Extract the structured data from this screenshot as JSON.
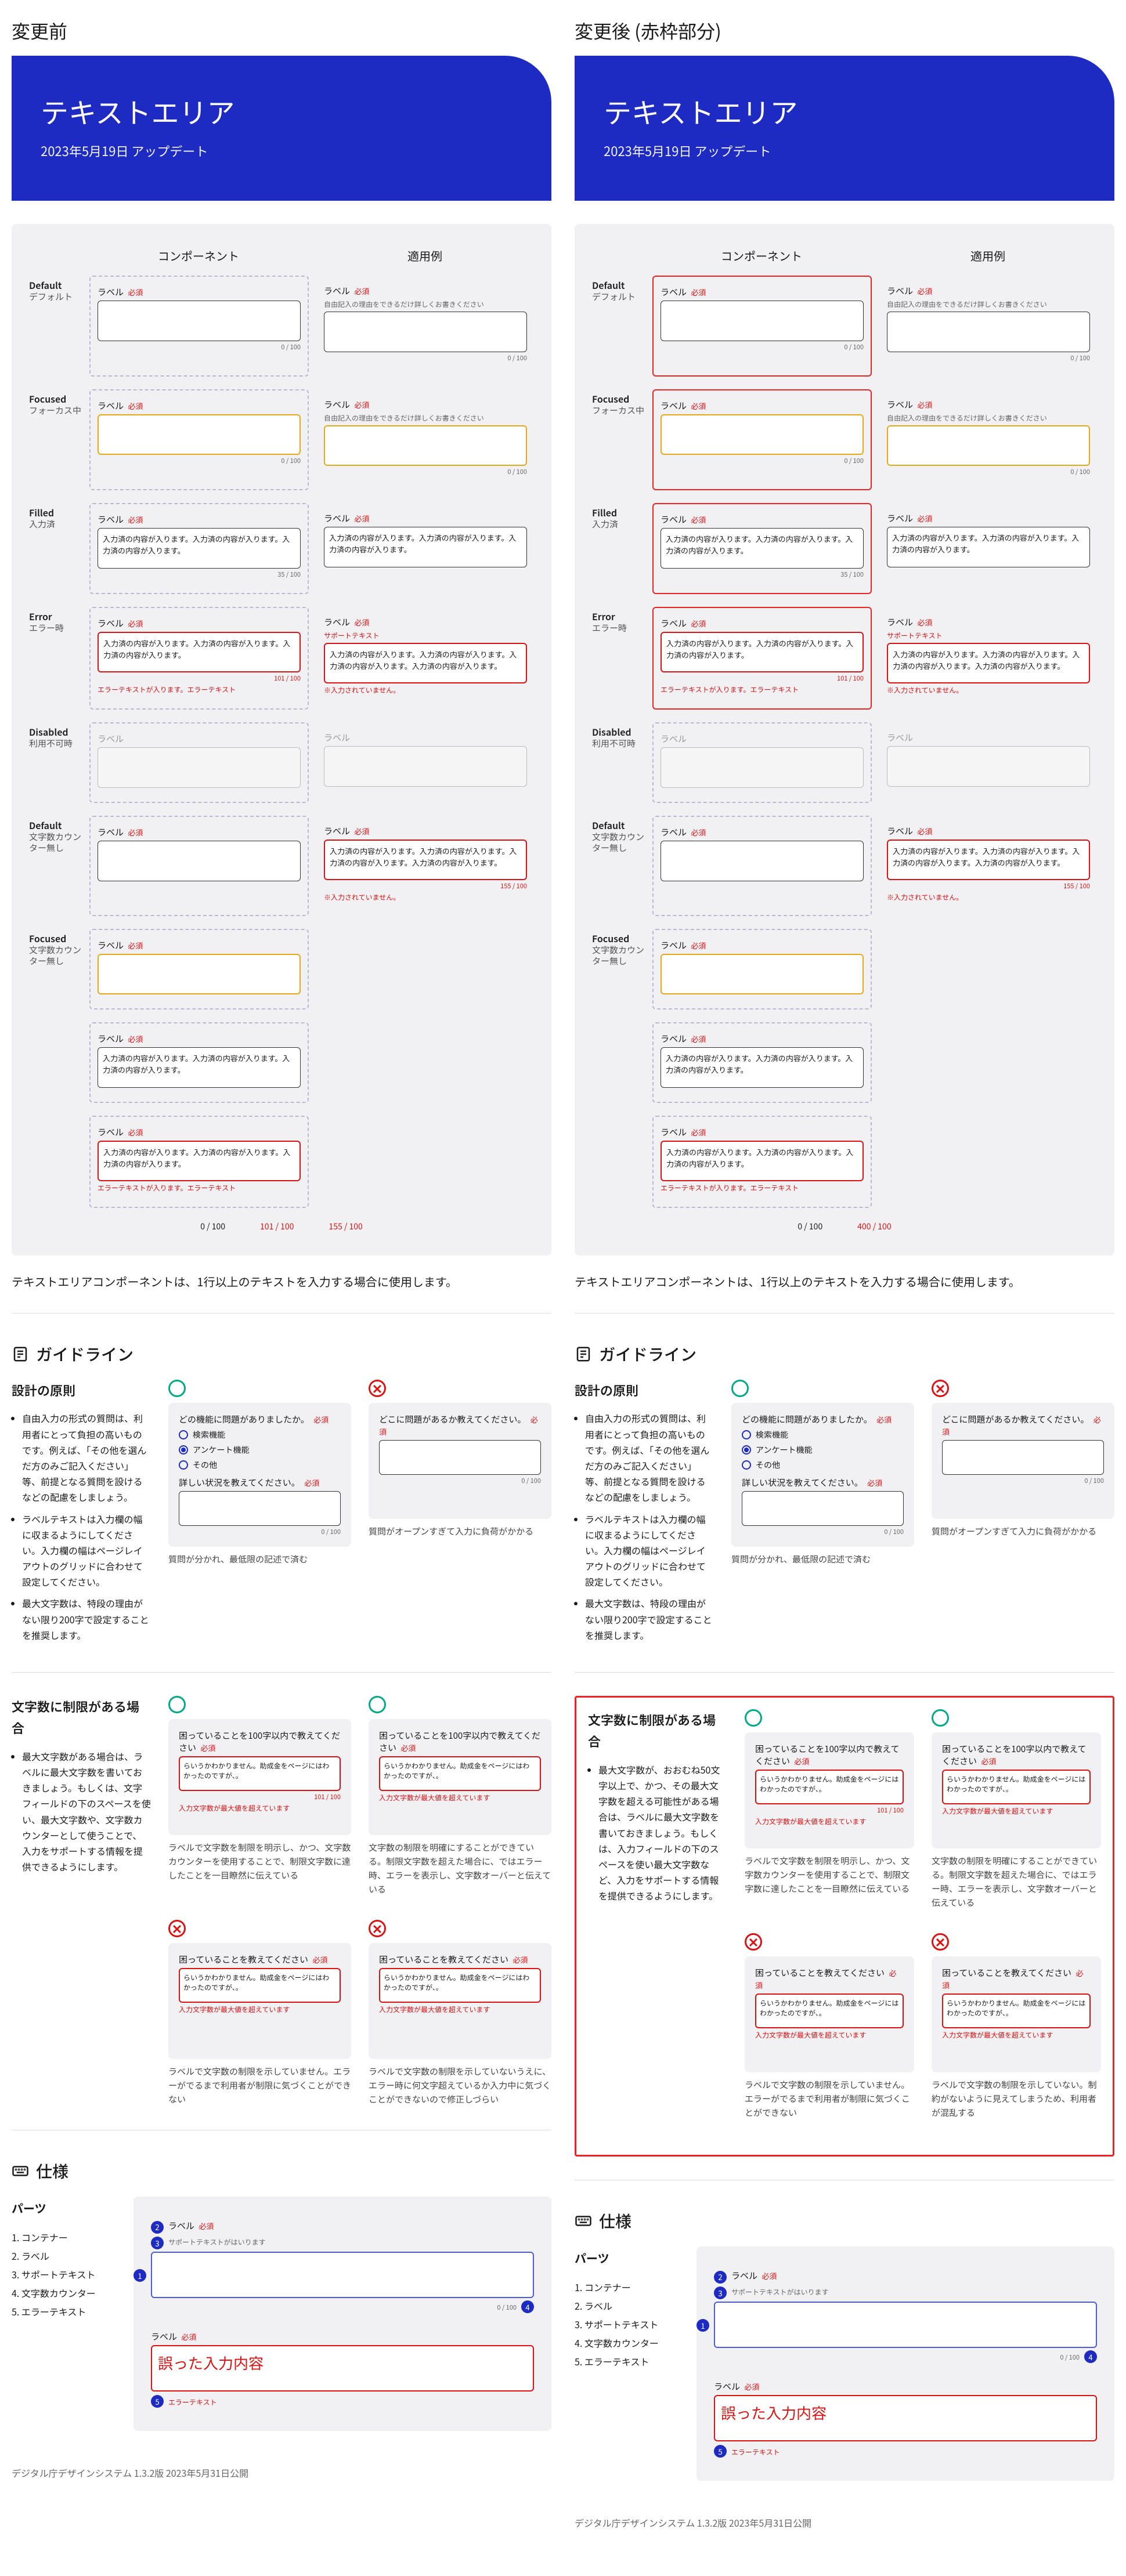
{
  "columns": {
    "before": "変更前",
    "after": "変更後 (赤枠部分)"
  },
  "hero": {
    "title": "テキストエリア",
    "date": "2023年5月19日 アップデート"
  },
  "componentSection": {
    "colComponent": "コンポーネント",
    "colUsage": "適用例",
    "states": [
      {
        "key": "default",
        "en": "Default",
        "ja": "デフォルト"
      },
      {
        "key": "focused",
        "en": "Focused",
        "ja": "フォーカス中"
      },
      {
        "key": "filled",
        "en": "Filled",
        "ja": "入力済"
      },
      {
        "key": "error",
        "en": "Error",
        "ja": "エラー時"
      },
      {
        "key": "disabled",
        "en": "Disabled",
        "ja": "利用不可時"
      },
      {
        "key": "defaultCounter",
        "en": "Default",
        "ja": "文字数カウンター無し"
      },
      {
        "key": "focusedCounter",
        "en": "Focused",
        "ja": "文字数カウンター無し"
      }
    ],
    "label": "ラベル",
    "required": "必須",
    "support": "自由記入の理由をできるだけ詳しくお書きください",
    "supportAlt": "サポートテキスト",
    "filledText": "入力済の内容が入ります。入力済の内容が入ります。入力済の内容が入ります。",
    "filledTextLong": "入力済の内容が入ります。入力済の内容が入ります。入力済の内容が入ります。入力済の内容が入ります。",
    "errorMsg": "エラーテキストが入ります。エラーテキスト",
    "errorMsgAlt": "※入力されていません。",
    "counts": {
      "empty": "0 / 100",
      "filled": "35 / 100",
      "error": "101 / 100",
      "overLong": "155 / 100"
    },
    "counterRow": [
      "0 / 100",
      "101 / 100",
      "155 / 100"
    ],
    "counterRowAfter": [
      "0 / 100",
      "400 / 100"
    ]
  },
  "caption": "テキストエリアコンポーネントは、1行以上のテキストを入力する場合に使用します。",
  "guidelineTitle": "ガイドライン",
  "principles": {
    "heading": "設計の原則",
    "bullets": [
      "自由入力の形式の質問は、利用者にとって負担の高いものです。例えば、「その他を選んだ方のみご記入ください」等、前提となる質問を設けるなどの配慮をしましょう。",
      "ラベルテキストは入力欄の幅に収まるようにしてください。入力欄の幅はページレイアウトのグリッドに合わせて設定してください。",
      "最大文字数は、特段の理由がない限り200字で設定することを推奨します。"
    ],
    "goodLabel": "どの機能に問題がありましたか。",
    "radios": [
      "検索機能",
      "アンケート機能",
      "その他"
    ],
    "goodTaLabel": "詳しい状況を教えてください。",
    "goodCaption": "質問が分かれ、最低限の記述で済む",
    "badLabel": "どこに問題があるか教えてください。",
    "badCaption": "質問がオープンすぎて入力に負荷がかかる",
    "count": "0 / 100"
  },
  "charLimit": {
    "heading": "文字数に制限がある場合",
    "bulletsBefore": [
      "最大文字数がある場合は、ラベルに最大文字数を書いておきましょう。もしくは、文字フィールドの下のスペースを使い、最大文字数や、文字数カウンターとして使うことで、入力をサポートする情報を提供できるようにします。"
    ],
    "bulletsAfter": [
      "最大文字数が、おおむね50文字以上で、かつ、その最大文字数を超える可能性がある場合は、ラベルに最大文字数を書いておきましょう。もしくは、入力フィールドの下のスペースを使い最大文字数など、入力をサポートする情報を提供できるようにします。"
    ],
    "goodA": {
      "label": "困っていることを100字以内で教えてください",
      "text": "らいうかわかりません。助成金をページにはわかったのですが、。",
      "count": "101 / 100",
      "err": "入力文字数が最大値を超えています",
      "caption": "ラベルで文字数を制限を明示し、かつ、文字数カウンターを使用することで、制限文字数に達したことを一目瞭然に伝えている"
    },
    "goodB": {
      "label": "困っていることを100字以内で教えてください",
      "text": "らいうかわかりません。助成金をページにはわかったのですが、。",
      "err": "入力文字数が最大値を超えています",
      "caption": "文字数の制限を明確にすることができている。制限文字数を超えた場合に、ではエラー時、エラーを表示し、文字数オーバーと伝えている"
    },
    "badA": {
      "label": "困っていることを教えてください",
      "text": "らいうかわかりません。助成金をページにはわかったのですが、。",
      "err": "入力文字数が最大値を超えています",
      "caption": "ラベルで文字数の制限を示していません。エラーがでるまで利用者が制限に気づくことができない"
    },
    "badB": {
      "label": "困っていることを教えてください",
      "text": "らいうかわかりません。助成金をページにはわかったのですが、。",
      "err": "入力文字数が最大値を超えています",
      "caption": "ラベルで文字数の制限を示していないうえに、エラー時に何文字超えているか入力中に気づくことができないので修正しづらい"
    },
    "badBAfter": {
      "caption": "ラベルで文字数の制限を示していない。制約がないように見えてしまうため、利用者が混乱する"
    }
  },
  "specTitle": "仕様",
  "parts": {
    "heading": "パーツ",
    "list": [
      "1. コンテナー",
      "2. ラベル",
      "3. サポートテキスト",
      "4. 文字数カウンター",
      "5. エラーテキスト"
    ],
    "label": "ラベル",
    "required": "必須",
    "support": "サポートテキストがはいります",
    "count": "0 / 100",
    "errText": "誤った入力内容",
    "errLabel": "エラーテキスト"
  },
  "footer": "デジタル庁デザインシステム 1.3.2版 2023年5月31日公開"
}
